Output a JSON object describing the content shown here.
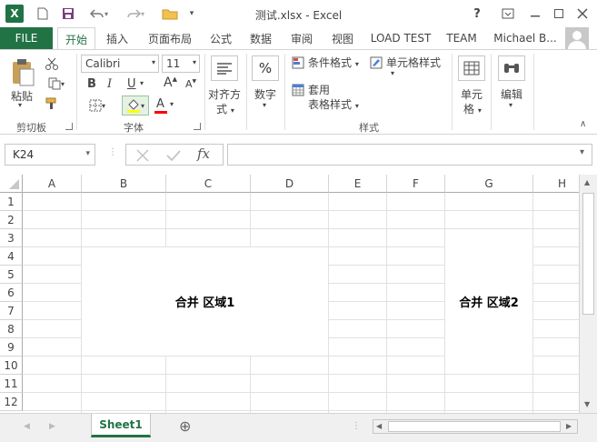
{
  "title": "测试.xlsx - Excel",
  "icons": {
    "app": "excel-icon",
    "new": "new-document-icon",
    "save": "save-icon",
    "undo": "undo-icon",
    "redo": "redo-icon",
    "open": "open-folder-icon",
    "customize": "customize-qat-icon",
    "help": "help-icon",
    "ribbon_display": "ribbon-display-icon",
    "minimize": "minimize-icon",
    "maximize": "maximize-icon",
    "close": "close-icon"
  },
  "help_label": "?",
  "tabs": {
    "file": "FILE",
    "items": [
      "开始",
      "插入",
      "页面布局",
      "公式",
      "数据",
      "审阅",
      "视图",
      "LOAD TEST",
      "TEAM"
    ],
    "active": "开始",
    "user": "Michael B..."
  },
  "ribbon": {
    "clipboard": {
      "paste": "粘贴",
      "group": "剪切板"
    },
    "font": {
      "name": "Calibri",
      "size": "11",
      "bold": "B",
      "italic": "I",
      "underline": "U",
      "grow": "A",
      "shrink": "A",
      "font_color": "A",
      "group": "字体"
    },
    "alignment": {
      "label_line1": "对齐方",
      "label_line2": "式"
    },
    "number": {
      "symbol": "%",
      "label": "数字"
    },
    "styles": {
      "conditional": "条件格式",
      "cell_styles": "单元格样式",
      "table_line1": "套用",
      "table_line2": "表格样式",
      "group": "样式"
    },
    "cells": {
      "label_line1": "单元",
      "label_line2": "格"
    },
    "editing": {
      "label": "编辑"
    }
  },
  "formula_bar": {
    "name_box": "K24",
    "fx": "fx",
    "formula_value": ""
  },
  "grid": {
    "columns": [
      "A",
      "B",
      "C",
      "D",
      "E",
      "F",
      "G",
      "H"
    ],
    "rows": [
      "1",
      "2",
      "3",
      "4",
      "5",
      "6",
      "7",
      "8",
      "9",
      "10",
      "11",
      "12"
    ],
    "merged1": "合并 区域1",
    "merged2": "合并 区域2"
  },
  "sheets": {
    "active": "Sheet1",
    "add": "⊕"
  },
  "colors": {
    "excel_green": "#217346",
    "highlight_yellow": "#ffff00",
    "font_red": "#ff0000"
  }
}
